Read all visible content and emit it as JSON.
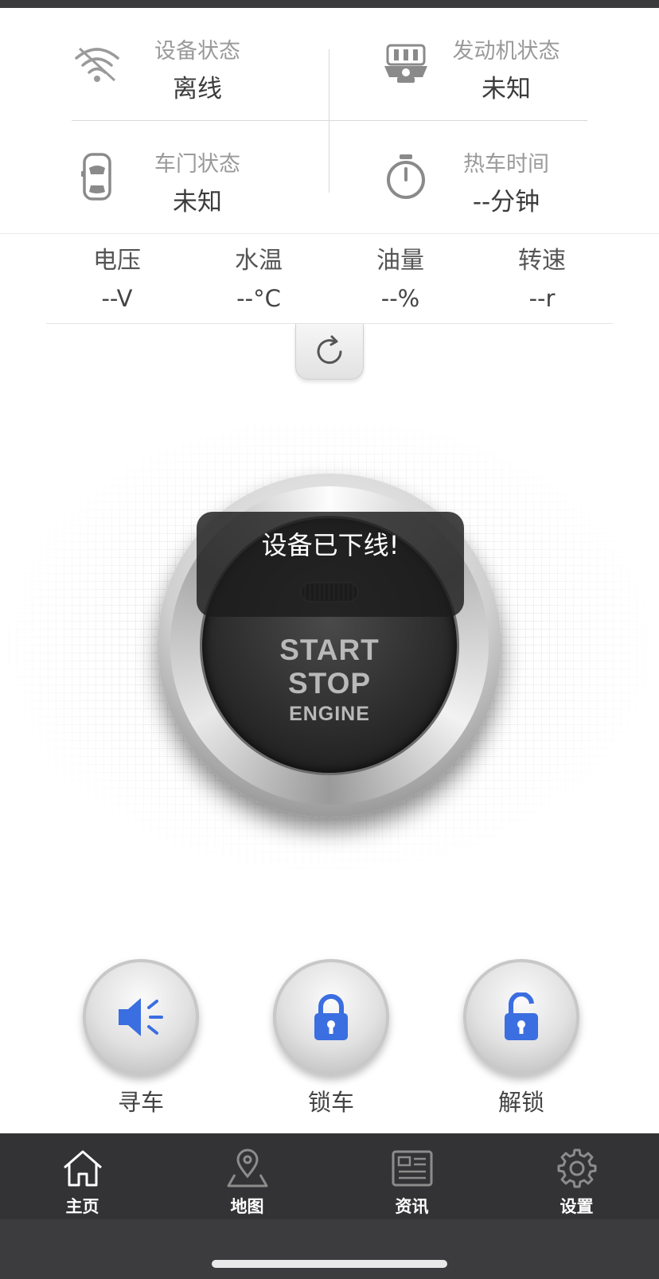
{
  "status": {
    "device": {
      "label": "设备状态",
      "value": "离线",
      "icon": "wifi-icon"
    },
    "engine": {
      "label": "发动机状态",
      "value": "未知",
      "icon": "engine-icon"
    },
    "door": {
      "label": "车门状态",
      "value": "未知",
      "icon": "car-door-icon"
    },
    "warmup": {
      "label": "热车时间",
      "value": "--分钟",
      "icon": "stopwatch-icon"
    }
  },
  "metrics": [
    {
      "label": "电压",
      "value": "--V"
    },
    {
      "label": "水温",
      "value": "--°C"
    },
    {
      "label": "油量",
      "value": "--%"
    },
    {
      "label": "转速",
      "value": "--r"
    }
  ],
  "engine_button": {
    "line1": "START",
    "line2": "STOP",
    "line3": "ENGINE"
  },
  "toast": {
    "message": "设备已下线!"
  },
  "actions": [
    {
      "label": "寻车",
      "icon": "speaker-icon"
    },
    {
      "label": "锁车",
      "icon": "lock-icon"
    },
    {
      "label": "解锁",
      "icon": "unlock-icon"
    }
  ],
  "tabs": [
    {
      "label": "主页",
      "icon": "home-icon"
    },
    {
      "label": "地图",
      "icon": "map-pin-icon"
    },
    {
      "label": "资讯",
      "icon": "news-icon"
    },
    {
      "label": "设置",
      "icon": "gear-icon"
    }
  ],
  "colors": {
    "accent_blue": "#3b6ee0",
    "tab_bar": "#333335",
    "toast_bg": "#1c1c1c"
  }
}
